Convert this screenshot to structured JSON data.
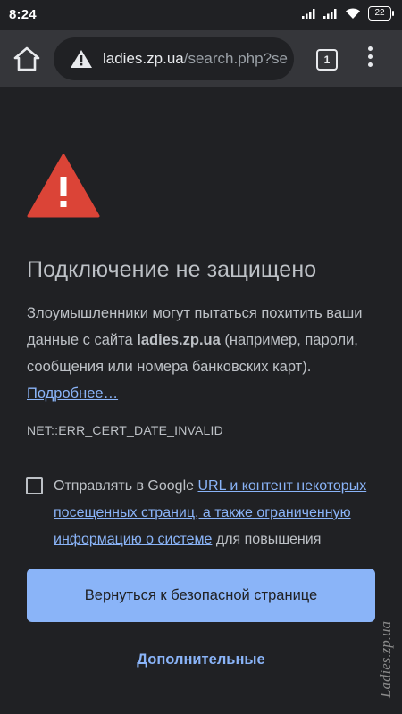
{
  "status_bar": {
    "time": "8:24",
    "battery": "22"
  },
  "toolbar": {
    "url_host": "ladies.zp.ua",
    "url_path": "/search.php?se",
    "tab_count": "1"
  },
  "interstitial": {
    "title": "Подключение не защищено",
    "body_before": "Злоумышленники могут пытаться похитить ваши данные с сайта ",
    "body_host": "ladies.zp.ua",
    "body_after": " (например, пароли, сообщения или номера банковских карт). ",
    "learn_more": "Подробнее…",
    "error_code": "NET::ERR_CERT_DATE_INVALID",
    "optin_prefix": "Отправлять в Google ",
    "optin_link": "URL и контент некоторых посещенных страниц, а также ограниченную информацию о системе",
    "optin_suffix": " для повышения",
    "back_button": "Вернуться к безопасной странице",
    "advanced_button": "Дополнительные"
  },
  "watermark": "Ladies.zp.ua",
  "colors": {
    "accent": "#8ab4f8",
    "warning_red": "#db4437",
    "background": "#202124",
    "toolbar": "#35363a"
  },
  "icons": [
    "home-icon",
    "warning-icon",
    "tab-switcher-icon",
    "more-vert-icon",
    "wifi-icon",
    "signal-icon",
    "battery-icon"
  ]
}
